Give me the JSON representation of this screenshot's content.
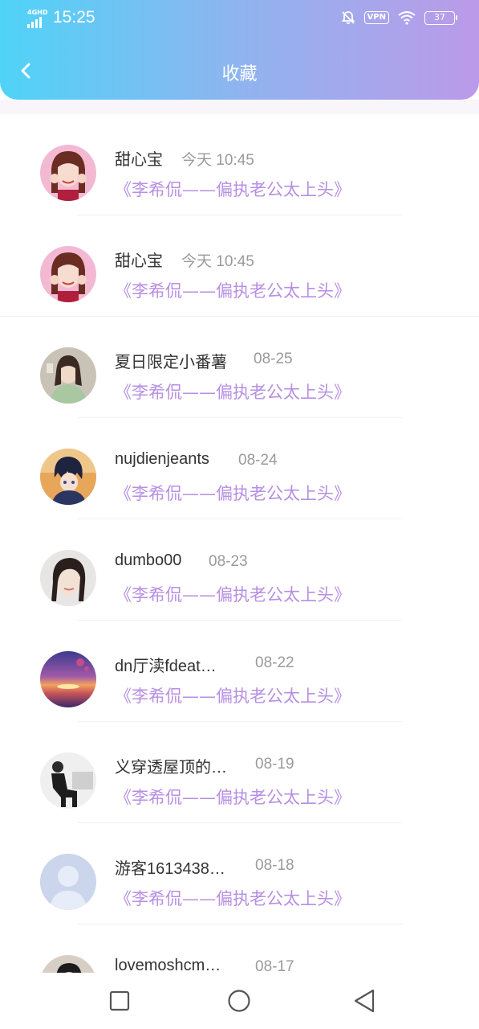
{
  "status_bar": {
    "network": "4GHD",
    "time": "15:25",
    "vpn": "VPN",
    "battery": "37"
  },
  "header": {
    "title": "收藏"
  },
  "icons": {
    "back": "chevron-left-icon",
    "mute": "bell-off-icon",
    "wifi": "wifi-icon",
    "nav_recent": "square-icon",
    "nav_home": "circle-icon",
    "nav_back": "triangle-back-icon"
  },
  "colors": {
    "header_start": "#4fd3f7",
    "header_end": "#bb9ae9",
    "book_title": "#b78fe3"
  },
  "favorites": [
    {
      "user": "甜心宝",
      "time": "今天 10:45",
      "book": "《李希侃——偏执老公太上头》",
      "avatar": "girl-pink"
    },
    {
      "user": "甜心宝",
      "time": "今天 10:45",
      "book": "《李希侃——偏执老公太上头》",
      "avatar": "girl-pink"
    },
    {
      "user": "夏日限定小番薯",
      "time": "08-25",
      "book": "《李希侃——偏执老公太上头》",
      "avatar": "girl-green"
    },
    {
      "user": "nujdienjeants",
      "time": "08-24",
      "book": "《李希侃——偏执老公太上头》",
      "avatar": "anime-boy"
    },
    {
      "user": "dumbo00",
      "time": "08-23",
      "book": "《李希侃——偏执老公太上头》",
      "avatar": "girl-face"
    },
    {
      "user": "dn厅渎fdeat…",
      "time": "08-22",
      "book": "《李希侃——偏执老公太上头》",
      "avatar": "sunset"
    },
    {
      "user": "义穿透屋顶的…",
      "time": "08-19",
      "book": "《李希侃——偏执老公太上头》",
      "avatar": "sitting-person"
    },
    {
      "user": "游客1613438…",
      "time": "08-18",
      "book": "《李希侃——偏执老公太上头》",
      "avatar": "default-user"
    },
    {
      "user": "lovemoshcm…",
      "time": "08-17",
      "book": "",
      "avatar": "boy-photo"
    }
  ]
}
